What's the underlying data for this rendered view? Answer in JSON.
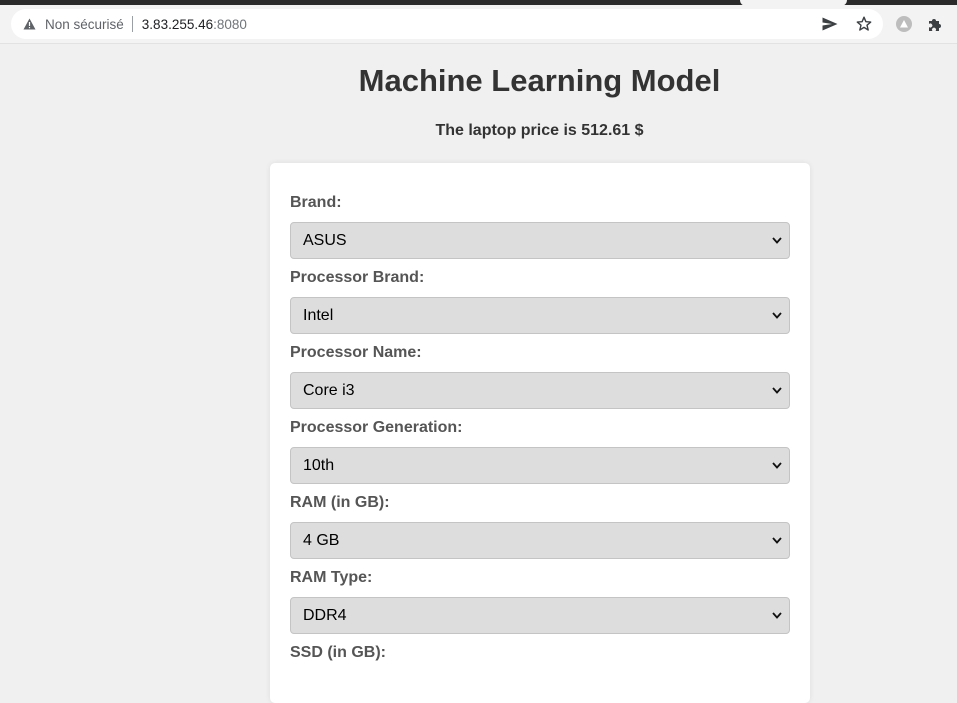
{
  "browser": {
    "security_label": "Non sécurisé",
    "url_host": "3.83.255.46",
    "url_port": ":8080"
  },
  "page": {
    "title": "Machine Learning Model",
    "result": "The laptop price is 512.61 $"
  },
  "form": {
    "fields": [
      {
        "label": "Brand:",
        "value": "ASUS"
      },
      {
        "label": "Processor Brand:",
        "value": "Intel"
      },
      {
        "label": "Processor Name:",
        "value": "Core i3"
      },
      {
        "label": "Processor Generation:",
        "value": "10th"
      },
      {
        "label": "RAM (in GB):",
        "value": "4 GB"
      },
      {
        "label": "RAM Type:",
        "value": "DDR4"
      },
      {
        "label": "SSD (in GB):",
        "value": ""
      }
    ]
  }
}
